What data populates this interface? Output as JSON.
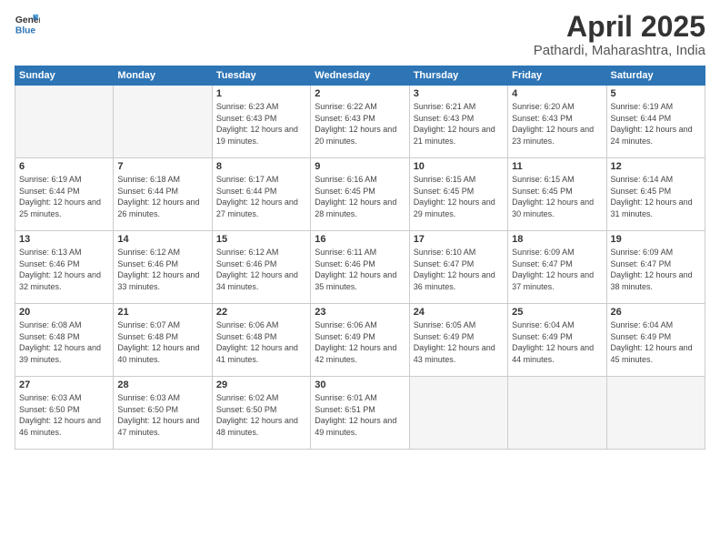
{
  "logo": {
    "general": "General",
    "blue": "Blue"
  },
  "title": "April 2025",
  "subtitle": "Pathardi, Maharashtra, India",
  "weekdays": [
    "Sunday",
    "Monday",
    "Tuesday",
    "Wednesday",
    "Thursday",
    "Friday",
    "Saturday"
  ],
  "weeks": [
    [
      {
        "day": "",
        "info": ""
      },
      {
        "day": "",
        "info": ""
      },
      {
        "day": "1",
        "info": "Sunrise: 6:23 AM\nSunset: 6:43 PM\nDaylight: 12 hours\nand 19 minutes."
      },
      {
        "day": "2",
        "info": "Sunrise: 6:22 AM\nSunset: 6:43 PM\nDaylight: 12 hours\nand 20 minutes."
      },
      {
        "day": "3",
        "info": "Sunrise: 6:21 AM\nSunset: 6:43 PM\nDaylight: 12 hours\nand 21 minutes."
      },
      {
        "day": "4",
        "info": "Sunrise: 6:20 AM\nSunset: 6:43 PM\nDaylight: 12 hours\nand 23 minutes."
      },
      {
        "day": "5",
        "info": "Sunrise: 6:19 AM\nSunset: 6:44 PM\nDaylight: 12 hours\nand 24 minutes."
      }
    ],
    [
      {
        "day": "6",
        "info": "Sunrise: 6:19 AM\nSunset: 6:44 PM\nDaylight: 12 hours\nand 25 minutes."
      },
      {
        "day": "7",
        "info": "Sunrise: 6:18 AM\nSunset: 6:44 PM\nDaylight: 12 hours\nand 26 minutes."
      },
      {
        "day": "8",
        "info": "Sunrise: 6:17 AM\nSunset: 6:44 PM\nDaylight: 12 hours\nand 27 minutes."
      },
      {
        "day": "9",
        "info": "Sunrise: 6:16 AM\nSunset: 6:45 PM\nDaylight: 12 hours\nand 28 minutes."
      },
      {
        "day": "10",
        "info": "Sunrise: 6:15 AM\nSunset: 6:45 PM\nDaylight: 12 hours\nand 29 minutes."
      },
      {
        "day": "11",
        "info": "Sunrise: 6:15 AM\nSunset: 6:45 PM\nDaylight: 12 hours\nand 30 minutes."
      },
      {
        "day": "12",
        "info": "Sunrise: 6:14 AM\nSunset: 6:45 PM\nDaylight: 12 hours\nand 31 minutes."
      }
    ],
    [
      {
        "day": "13",
        "info": "Sunrise: 6:13 AM\nSunset: 6:46 PM\nDaylight: 12 hours\nand 32 minutes."
      },
      {
        "day": "14",
        "info": "Sunrise: 6:12 AM\nSunset: 6:46 PM\nDaylight: 12 hours\nand 33 minutes."
      },
      {
        "day": "15",
        "info": "Sunrise: 6:12 AM\nSunset: 6:46 PM\nDaylight: 12 hours\nand 34 minutes."
      },
      {
        "day": "16",
        "info": "Sunrise: 6:11 AM\nSunset: 6:46 PM\nDaylight: 12 hours\nand 35 minutes."
      },
      {
        "day": "17",
        "info": "Sunrise: 6:10 AM\nSunset: 6:47 PM\nDaylight: 12 hours\nand 36 minutes."
      },
      {
        "day": "18",
        "info": "Sunrise: 6:09 AM\nSunset: 6:47 PM\nDaylight: 12 hours\nand 37 minutes."
      },
      {
        "day": "19",
        "info": "Sunrise: 6:09 AM\nSunset: 6:47 PM\nDaylight: 12 hours\nand 38 minutes."
      }
    ],
    [
      {
        "day": "20",
        "info": "Sunrise: 6:08 AM\nSunset: 6:48 PM\nDaylight: 12 hours\nand 39 minutes."
      },
      {
        "day": "21",
        "info": "Sunrise: 6:07 AM\nSunset: 6:48 PM\nDaylight: 12 hours\nand 40 minutes."
      },
      {
        "day": "22",
        "info": "Sunrise: 6:06 AM\nSunset: 6:48 PM\nDaylight: 12 hours\nand 41 minutes."
      },
      {
        "day": "23",
        "info": "Sunrise: 6:06 AM\nSunset: 6:49 PM\nDaylight: 12 hours\nand 42 minutes."
      },
      {
        "day": "24",
        "info": "Sunrise: 6:05 AM\nSunset: 6:49 PM\nDaylight: 12 hours\nand 43 minutes."
      },
      {
        "day": "25",
        "info": "Sunrise: 6:04 AM\nSunset: 6:49 PM\nDaylight: 12 hours\nand 44 minutes."
      },
      {
        "day": "26",
        "info": "Sunrise: 6:04 AM\nSunset: 6:49 PM\nDaylight: 12 hours\nand 45 minutes."
      }
    ],
    [
      {
        "day": "27",
        "info": "Sunrise: 6:03 AM\nSunset: 6:50 PM\nDaylight: 12 hours\nand 46 minutes."
      },
      {
        "day": "28",
        "info": "Sunrise: 6:03 AM\nSunset: 6:50 PM\nDaylight: 12 hours\nand 47 minutes."
      },
      {
        "day": "29",
        "info": "Sunrise: 6:02 AM\nSunset: 6:50 PM\nDaylight: 12 hours\nand 48 minutes."
      },
      {
        "day": "30",
        "info": "Sunrise: 6:01 AM\nSunset: 6:51 PM\nDaylight: 12 hours\nand 49 minutes."
      },
      {
        "day": "",
        "info": ""
      },
      {
        "day": "",
        "info": ""
      },
      {
        "day": "",
        "info": ""
      }
    ]
  ]
}
